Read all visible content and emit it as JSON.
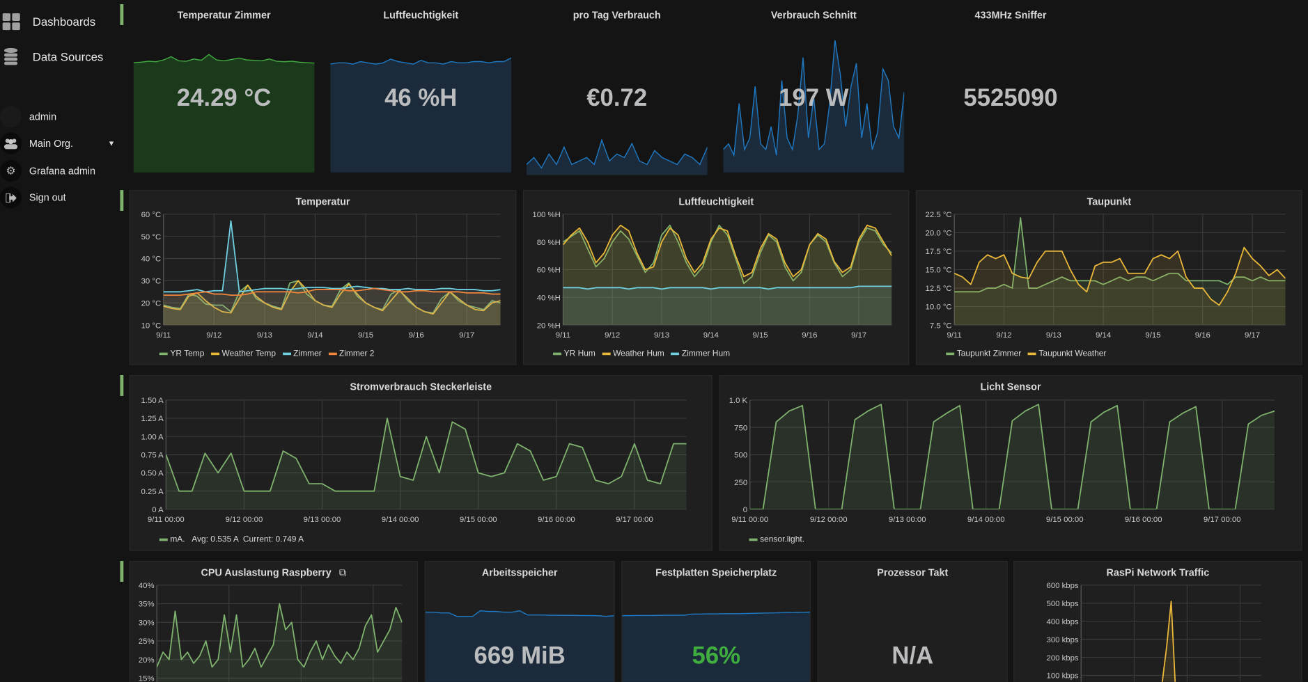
{
  "sidebar": {
    "main": [
      {
        "label": "Dashboards",
        "icon": "dashboards-grid-icon"
      },
      {
        "label": "Data Sources",
        "icon": "database-icon"
      }
    ],
    "user": {
      "name": "admin"
    },
    "items": [
      {
        "label": "Main Org.",
        "icon": "users-icon"
      },
      {
        "label": "Grafana admin",
        "icon": "gear-icon"
      },
      {
        "label": "Sign out",
        "icon": "sign-out-icon"
      }
    ]
  },
  "colors": {
    "green": "#7eb26d",
    "yellow": "#eab839",
    "cyan": "#6ed0e0",
    "orange": "#ef843c",
    "blue": "#1f78c1",
    "row_marker": "#7eb26d",
    "ok_green": "#3fae3f"
  },
  "singlestats": [
    {
      "title": "Temperatur Zimmer",
      "value": "24.29 °C",
      "spark_color": "#3fa83f",
      "spark_fill": "#1b3a1b",
      "spark_ylim": [
        0,
        38
      ],
      "spark": [
        24.2,
        24.3,
        24.5,
        24.4,
        24.8,
        25.5,
        24.6,
        24.5,
        25,
        24.7,
        26,
        24.8,
        24.6,
        24.9,
        25.2,
        24.8,
        24.7,
        24.6,
        25,
        24.5,
        24.4,
        24.5,
        24.3,
        24.2,
        24.1
      ]
    },
    {
      "title": "Luftfeuchtigkeit",
      "value": "46 %H",
      "spark_color": "#1f78c1",
      "spark_fill": "#1b2b3b",
      "spark_ylim": [
        0,
        70
      ],
      "spark": [
        44,
        44.5,
        44.5,
        44,
        45,
        44.5,
        44,
        44.5,
        46,
        45,
        44.5,
        44,
        45.5,
        44.5,
        44.5,
        44,
        45,
        44.5,
        44.5,
        45,
        45,
        44.5,
        45,
        45,
        46.5
      ]
    },
    {
      "title": "pro Tag Verbrauch",
      "value": "€0.72",
      "spark_color": "#1f78c1",
      "spark_fill": "#1b2b3b",
      "spark_ylim": [
        0,
        5
      ],
      "spark": [
        0.3,
        0.5,
        0.2,
        0.6,
        0.3,
        0.8,
        0.3,
        0.4,
        0.5,
        0.3,
        1.0,
        0.4,
        0.6,
        0.5,
        0.9,
        0.4,
        0.3,
        0.7,
        0.5,
        0.4,
        0.3,
        0.6,
        0.5,
        0.3,
        0.8
      ]
    },
    {
      "title": "Verbrauch Schnitt",
      "value": "197 W",
      "spark_color": "#1f78c1",
      "spark_fill": "#1b2b3b",
      "spark_ylim": [
        0,
        300
      ],
      "spark": [
        40,
        50,
        30,
        120,
        40,
        60,
        150,
        50,
        40,
        80,
        30,
        160,
        60,
        40,
        100,
        200,
        60,
        130,
        40,
        50,
        120,
        230,
        170,
        80,
        150,
        190,
        60,
        120,
        40,
        70,
        180,
        160,
        80,
        60,
        140
      ]
    },
    {
      "title": "433MHz Sniffer",
      "value": "5525090"
    }
  ],
  "graphs_row2": [
    {
      "title": "Temperatur",
      "ylim": [
        10,
        60
      ],
      "yticks": [
        [
          10,
          "10 °C"
        ],
        [
          20,
          "20 °C"
        ],
        [
          30,
          "30 °C"
        ],
        [
          40,
          "40 °C"
        ],
        [
          50,
          "50 °C"
        ],
        [
          60,
          "60 °C"
        ]
      ],
      "xticks": [
        "9/11",
        "9/12",
        "9/13",
        "9/14",
        "9/15",
        "9/16",
        "9/17"
      ],
      "x_end": "9/17 16:00",
      "series": [
        {
          "name": "YR Temp",
          "color": "#7eb26d",
          "values": [
            19,
            18,
            17.5,
            24,
            23,
            19.5,
            19,
            19,
            16,
            25,
            28,
            22,
            20,
            18.5,
            17.5,
            29,
            30,
            24,
            21,
            19,
            18.5,
            26,
            29,
            23,
            20,
            18,
            17,
            24,
            26,
            21,
            18,
            16,
            15.5,
            22,
            25,
            21,
            19,
            18,
            17,
            21,
            20
          ]
        },
        {
          "name": "Weather Temp",
          "color": "#eab839",
          "values": [
            18.5,
            17.5,
            17,
            23,
            24.5,
            21,
            18,
            16,
            15.5,
            22,
            28,
            23,
            20,
            18,
            17,
            25,
            30,
            26,
            21,
            19,
            18,
            24,
            28.5,
            24,
            20,
            18,
            16.5,
            21,
            25.5,
            22,
            18,
            16,
            15,
            20,
            25,
            22,
            19,
            17,
            16.5,
            20,
            21
          ]
        },
        {
          "name": "Zimmer",
          "color": "#6ed0e0",
          "values": [
            25,
            25,
            25,
            25.5,
            26,
            25,
            25.5,
            25.5,
            57,
            25,
            25.5,
            26,
            26.5,
            26.5,
            26.5,
            26,
            26.5,
            27,
            27,
            27,
            26.5,
            26.5,
            27,
            27.5,
            27,
            26.5,
            26.5,
            26,
            26,
            26.5,
            26,
            26,
            26,
            26.5,
            26.5,
            26,
            26,
            26,
            25.5,
            25.5,
            26
          ]
        },
        {
          "name": "Zimmer 2",
          "color": "#ef843c",
          "values": [
            23.5,
            23.5,
            23.5,
            24,
            24.5,
            25,
            24,
            24,
            23.5,
            23.5,
            24,
            25,
            25,
            25,
            25,
            25,
            24.5,
            25,
            26,
            26,
            26,
            26,
            25.5,
            25.5,
            26,
            26.5,
            26,
            25.5,
            25,
            25,
            25.5,
            25.5,
            25,
            25,
            25,
            25,
            24.5,
            24.5,
            24.5,
            24,
            24
          ]
        }
      ]
    },
    {
      "title": "Luftfeuchtigkeit",
      "ylim": [
        20,
        100
      ],
      "yticks": [
        [
          20,
          "20 %H"
        ],
        [
          40,
          "40 %H"
        ],
        [
          60,
          "60 %H"
        ],
        [
          80,
          "80 %H"
        ],
        [
          100,
          "100 %H"
        ]
      ],
      "xticks": [
        "9/11",
        "9/12",
        "9/13",
        "9/14",
        "9/15",
        "9/16",
        "9/17"
      ],
      "x_end": "9/17 16:00",
      "series": [
        {
          "name": "YR Hum",
          "color": "#7eb26d",
          "values": [
            80,
            84,
            88,
            75,
            62,
            68,
            80,
            88,
            82,
            70,
            58,
            65,
            85,
            92,
            80,
            65,
            55,
            62,
            80,
            92,
            85,
            68,
            50,
            55,
            72,
            85,
            80,
            62,
            52,
            58,
            78,
            85,
            80,
            65,
            55,
            60,
            80,
            90,
            88,
            78,
            72
          ]
        },
        {
          "name": "Weather Hum",
          "color": "#eab839",
          "values": [
            78,
            85,
            90,
            80,
            65,
            72,
            85,
            92,
            88,
            72,
            60,
            62,
            80,
            90,
            85,
            68,
            58,
            65,
            82,
            90,
            88,
            70,
            55,
            58,
            75,
            86,
            82,
            65,
            55,
            60,
            78,
            86,
            82,
            66,
            58,
            62,
            82,
            92,
            90,
            80,
            70
          ]
        },
        {
          "name": "Zimmer Hum",
          "color": "#6ed0e0",
          "values": [
            47,
            47,
            47,
            46,
            47,
            47,
            47,
            47,
            46,
            47,
            47,
            47,
            46,
            47,
            47,
            47,
            47,
            47,
            46,
            47,
            47,
            47,
            47,
            47,
            47,
            46,
            47,
            47,
            47,
            47,
            47,
            47,
            47,
            47,
            47,
            47,
            48,
            48,
            48,
            48,
            48
          ]
        }
      ]
    },
    {
      "title": "Taupunkt",
      "ylim": [
        7.5,
        22.5
      ],
      "yticks": [
        [
          7.5,
          "7.5 °C"
        ],
        [
          10,
          "10.0 °C"
        ],
        [
          12.5,
          "12.5 °C"
        ],
        [
          15,
          "15.0 °C"
        ],
        [
          17.5,
          "17.5 °C"
        ],
        [
          20,
          "20.0 °C"
        ],
        [
          22.5,
          "22.5 °C"
        ]
      ],
      "xticks": [
        "9/11",
        "9/12",
        "9/13",
        "9/14",
        "9/15",
        "9/16",
        "9/17"
      ],
      "x_end": "9/17 16:00",
      "series": [
        {
          "name": "Taupunkt Zimmer",
          "color": "#7eb26d",
          "values": [
            12,
            12,
            12,
            12,
            12.5,
            12.5,
            13,
            12.5,
            22,
            12.5,
            12.5,
            13,
            13.5,
            14,
            13.5,
            13.5,
            13.5,
            13.5,
            13,
            13.5,
            14,
            13.5,
            14,
            14,
            13.5,
            14,
            14.5,
            14.5,
            13.5,
            13.5,
            13.5,
            13.5,
            13.5,
            13,
            14,
            14,
            13.5,
            14,
            13.5,
            13.5,
            13.5
          ]
        },
        {
          "name": "Taupunkt Weather",
          "color": "#eab839",
          "values": [
            14.5,
            14,
            13,
            16,
            17,
            16.5,
            17,
            14.5,
            14,
            13.8,
            16,
            17.5,
            17.5,
            17.5,
            15,
            13,
            12,
            15.5,
            16,
            16,
            16.5,
            14.5,
            14.5,
            14.5,
            16.5,
            17,
            16.5,
            17.5,
            14,
            12.5,
            12.5,
            11,
            10.2,
            12,
            14.5,
            18,
            16.5,
            15.5,
            14.2,
            15,
            13.8
          ]
        }
      ]
    }
  ],
  "graphs_row3": [
    {
      "title": "Stromverbrauch Steckerleiste",
      "ylim": [
        0,
        1.5
      ],
      "yticks": [
        [
          0,
          "0 A"
        ],
        [
          0.25,
          "0.25 A"
        ],
        [
          0.5,
          "0.50 A"
        ],
        [
          0.75,
          "0.75 A"
        ],
        [
          1,
          "1.00 A"
        ],
        [
          1.25,
          "1.25 A"
        ],
        [
          1.5,
          "1.50 A"
        ]
      ],
      "xticks": [
        "9/11 00:00",
        "9/12 00:00",
        "9/13 00:00",
        "9/14 00:00",
        "9/15 00:00",
        "9/16 00:00",
        "9/17 00:00"
      ],
      "x_end": "9/17 16:00",
      "series": [
        {
          "name": "mA.",
          "color": "#7eb26d",
          "values": [
            0.75,
            0.25,
            0.25,
            0.77,
            0.5,
            0.77,
            0.25,
            0.25,
            0.25,
            0.8,
            0.7,
            0.35,
            0.35,
            0.25,
            0.25,
            0.25,
            0.25,
            1.25,
            0.45,
            0.4,
            1.0,
            0.5,
            1.2,
            1.1,
            0.5,
            0.45,
            0.5,
            0.9,
            0.8,
            0.4,
            0.45,
            0.9,
            0.85,
            0.4,
            0.35,
            0.45,
            0.9,
            0.4,
            0.35,
            0.9,
            0.9
          ]
        }
      ],
      "legend_extra": "Avg: 0.535 A  Current: 0.749 A"
    },
    {
      "title": "Licht Sensor",
      "ylim": [
        0,
        1000
      ],
      "yticks": [
        [
          0,
          "0"
        ],
        [
          250,
          "250"
        ],
        [
          500,
          "500"
        ],
        [
          750,
          "750"
        ],
        [
          1000,
          "1.0 K"
        ]
      ],
      "xticks": [
        "9/11 00:00",
        "9/12 00:00",
        "9/13 00:00",
        "9/14 00:00",
        "9/15 00:00",
        "9/16 00:00",
        "9/17 00:00"
      ],
      "x_end": "9/17 16:00",
      "series": [
        {
          "name": "sensor.light.",
          "color": "#7eb26d",
          "values": [
            0,
            0,
            800,
            900,
            950,
            0,
            0,
            0,
            820,
            900,
            960,
            0,
            0,
            0,
            800,
            880,
            950,
            0,
            0,
            0,
            810,
            900,
            960,
            0,
            0,
            0,
            800,
            890,
            950,
            0,
            0,
            0,
            800,
            880,
            940,
            0,
            0,
            0,
            780,
            860,
            900
          ]
        }
      ]
    }
  ],
  "row4": {
    "cpu": {
      "title": "CPU Auslastung Raspberry",
      "link_icon": "external-link-icon",
      "ylim": [
        10,
        40
      ],
      "yticks": [
        [
          15,
          "15%"
        ],
        [
          20,
          "20%"
        ],
        [
          25,
          "25%"
        ],
        [
          30,
          "30%"
        ],
        [
          35,
          "35%"
        ],
        [
          40,
          "40%"
        ]
      ],
      "series": [
        {
          "color": "#7eb26d",
          "values": [
            18,
            22,
            20,
            33,
            20,
            22,
            19,
            21,
            25,
            18,
            20,
            32,
            22,
            32,
            18,
            20,
            23,
            18,
            21,
            24,
            35,
            28,
            30,
            20,
            18,
            22,
            25,
            20,
            24,
            21,
            19,
            22,
            20,
            23,
            29,
            32,
            22,
            25,
            28,
            34,
            30
          ]
        }
      ]
    },
    "memory": {
      "title": "Arbeitsspeicher",
      "value": "669 MiB",
      "spark_ylim": [
        0,
        1000
      ],
      "spark_color": "#1f78c1",
      "spark_fill": "#1b2b3b",
      "spark": [
        640,
        640,
        635,
        635,
        610,
        610,
        610,
        650,
        645,
        645,
        640,
        640,
        650,
        620,
        620,
        620,
        618,
        618,
        617,
        617,
        616,
        616,
        615,
        610,
        615
      ]
    },
    "disk": {
      "title": "Festplatten Speicherplatz",
      "value": "56%",
      "value_color": "#3fae3f",
      "spark_ylim": [
        0,
        90
      ],
      "spark_color": "#1f78c1",
      "spark_fill": "#1b2b3b",
      "spark": [
        55.4,
        55.4,
        55.5,
        55.5,
        55.5,
        55.6,
        55.6,
        55.6,
        55.7,
        56.4,
        56.4,
        56.5,
        56.5,
        56.6,
        56.6,
        56.7,
        56.8,
        56.9,
        57,
        57.1,
        57.2,
        57.3,
        57.4,
        57.5,
        57.6
      ]
    },
    "cpu_freq": {
      "title": "Prozessor Takt",
      "value": "N/A"
    },
    "network": {
      "title": "RasPi Network Traffic",
      "ylim": [
        0,
        600
      ],
      "yticks": [
        [
          100,
          "100 kbps"
        ],
        [
          200,
          "200 kbps"
        ],
        [
          300,
          "300 kbps"
        ],
        [
          400,
          "400 kbps"
        ],
        [
          500,
          "500 kbps"
        ],
        [
          600,
          "600 kbps"
        ]
      ],
      "series": [
        {
          "color": "#eab839",
          "values": [
            0,
            0,
            0,
            0,
            0,
            0,
            0,
            0,
            0,
            0,
            0,
            0,
            0,
            0,
            0,
            0,
            0,
            0,
            60,
            260,
            510,
            0,
            0,
            0,
            0,
            0,
            0,
            0,
            0,
            0,
            0,
            0,
            0,
            0,
            0,
            0,
            0,
            0,
            0,
            0,
            0
          ]
        }
      ]
    }
  }
}
